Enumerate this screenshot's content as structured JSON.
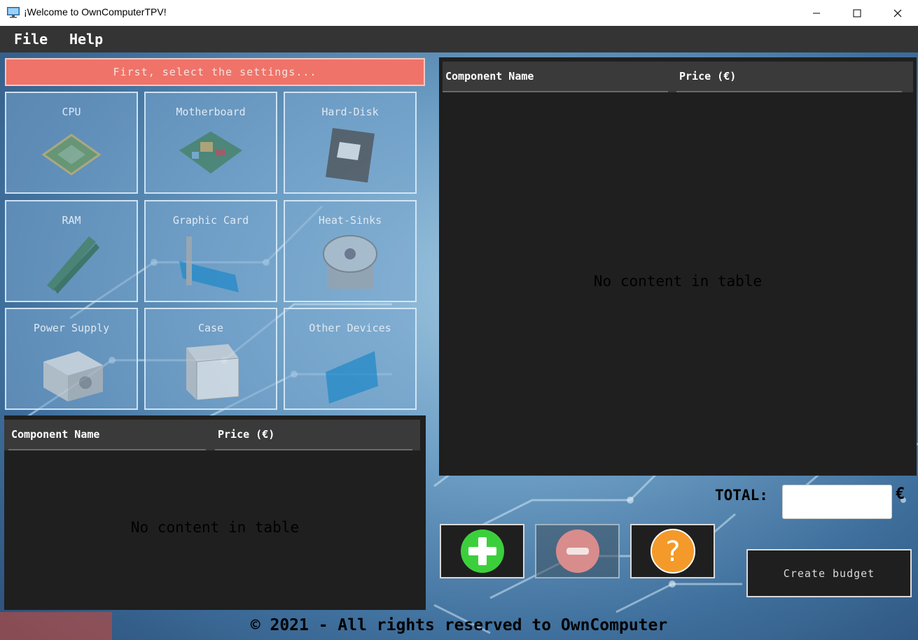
{
  "window": {
    "title": "¡Welcome to OwnComputerTPV!",
    "icon": "monitor-icon"
  },
  "menu": {
    "file": "File",
    "help": "Help"
  },
  "banner": "First, select the settings...",
  "categories": [
    {
      "label": "CPU",
      "icon": "cpu-icon"
    },
    {
      "label": "Motherboard",
      "icon": "motherboard-icon"
    },
    {
      "label": "Hard-Disk",
      "icon": "hard-disk-icon"
    },
    {
      "label": "RAM",
      "icon": "ram-icon"
    },
    {
      "label": "Graphic Card",
      "icon": "graphic-card-icon"
    },
    {
      "label": "Heat-Sinks",
      "icon": "heat-sink-icon"
    },
    {
      "label": "Power Supply",
      "icon": "power-supply-icon"
    },
    {
      "label": "Case",
      "icon": "case-icon"
    },
    {
      "label": "Other Devices",
      "icon": "other-devices-icon"
    }
  ],
  "catalog_table": {
    "columns": [
      "Component Name",
      "Price (€)"
    ],
    "rows": [],
    "empty_message": "No content in table"
  },
  "budget_table": {
    "columns": [
      "Component Name",
      "Price (€)"
    ],
    "rows": [],
    "empty_message": "No content in table"
  },
  "total": {
    "label": "TOTAL:",
    "value": "",
    "currency": "€"
  },
  "actions": {
    "add": "plus-icon",
    "remove": "minus-icon",
    "help": "question-icon",
    "create_budget": "Create budget"
  },
  "footer": "© 2021 - All rights reserved to OwnComputer",
  "colors": {
    "banner": "#ef7369",
    "panel": "#1f1f1f",
    "header": "#3a3a3a",
    "menubar": "#343434",
    "add": "#3ccf3c",
    "remove": "#d98c8c",
    "help": "#f39a2a"
  }
}
